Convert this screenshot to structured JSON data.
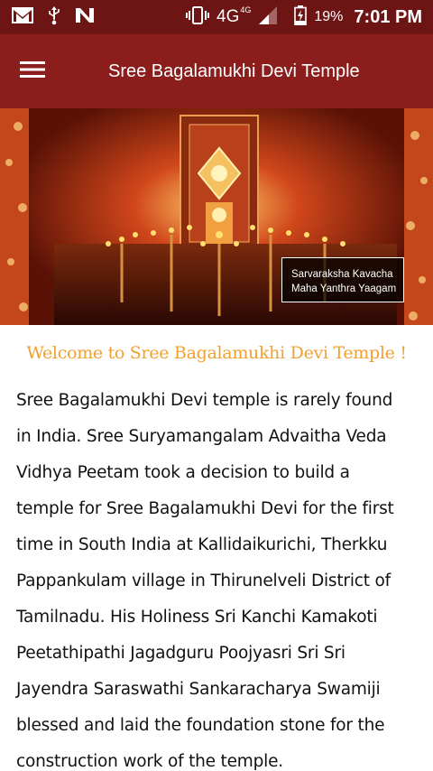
{
  "status_bar": {
    "network": "4G",
    "network_super": "4G",
    "battery": "19%",
    "time": "7:01 PM",
    "icons": [
      "gmail-icon",
      "usb-icon",
      "n-app-icon",
      "vibrate-icon",
      "signal-icon",
      "battery-icon"
    ]
  },
  "app_bar": {
    "title": "Sree Bagalamukhi Devi Temple",
    "menu_icon": "hamburger-menu-icon",
    "color": "#8b1d1d"
  },
  "banner": {
    "caption_line1": "Sarvaraksha Kavacha",
    "caption_line2": "Maha Yanthra Yaagam"
  },
  "content": {
    "welcome": "Welcome to Sree Bagalamukhi Devi Temple !",
    "welcome_color": "#f0a030",
    "body": "Sree Bagalamukhi Devi temple is rarely found in India. Sree Suryamangalam Advaitha Veda Vidhya Peetam took a decision to build a temple for Sree Bagalamukhi Devi for the first time in South India at Kallidaikurichi, Therkku Pappankulam village in Thirunelveli District of Tamilnadu. His Holiness Sri Kanchi Kamakoti Peetathipathi Jagadguru Poojyasri Sri Sri Jayendra Saraswathi Sankaracharya Swamiji blessed and laid the foundation stone for the construction work of the temple."
  }
}
